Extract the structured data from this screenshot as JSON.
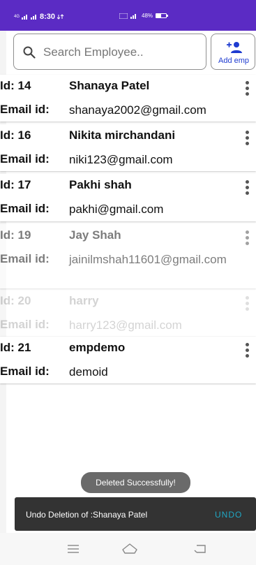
{
  "status_bar": {
    "network_left": "4G",
    "time": "8:30",
    "right_text": "48%",
    "battery_percent": 48
  },
  "search": {
    "placeholder": "Search Employee..",
    "value": ""
  },
  "add_button": {
    "label": "Add emp"
  },
  "employees": [
    {
      "id_label": "Id: 14",
      "name": "Shanaya Patel",
      "email_label": "Email id:",
      "email": "shanaya2002@gmail.com",
      "opacity": 1
    },
    {
      "id_label": "Id: 16",
      "name": "Nikita mirchandani",
      "email_label": "Email id:",
      "email": "niki123@gmail.com",
      "opacity": 1
    },
    {
      "id_label": "Id: 17",
      "name": "Pakhi shah",
      "email_label": "Email id:",
      "email": "pakhi@gmail.com",
      "opacity": 1
    },
    {
      "id_label": "Id: 19",
      "name": "Jay Shah",
      "email_label": "Email id:",
      "email": "jainilmshah11601@gmail.com",
      "opacity": 0.55
    },
    {
      "id_label": "Id: 20",
      "name": "harry",
      "email_label": "Email id:",
      "email": "harry123@gmail.com",
      "opacity": 0.18
    },
    {
      "id_label": "Id: 21",
      "name": "empdemo",
      "email_label": "Email id:",
      "email": "demoid",
      "opacity": 1
    }
  ],
  "toast": {
    "text": "Deleted  Successfully!"
  },
  "snackbar": {
    "message": "Undo Deletion of :Shanaya Patel",
    "action": "UNDO"
  }
}
